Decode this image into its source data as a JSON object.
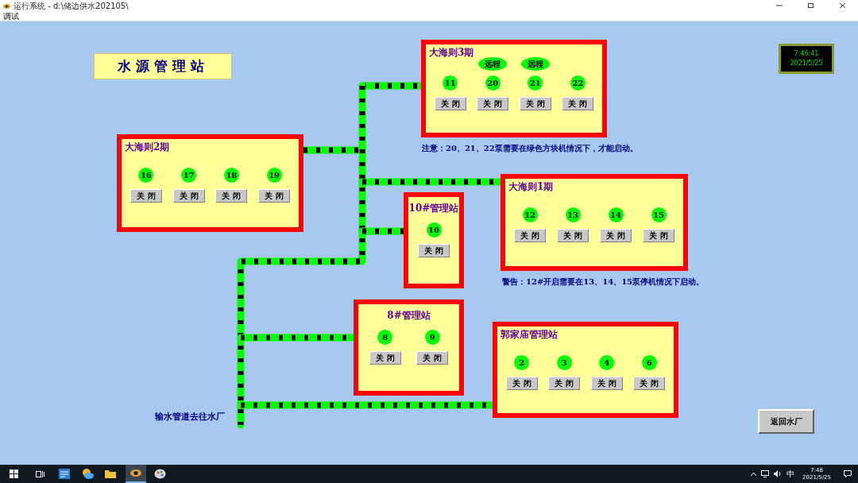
{
  "window": {
    "title": "运行系统 - d:\\储边供水202105\\",
    "menu": [
      "调试"
    ]
  },
  "header": {
    "title": "水源管理站"
  },
  "clock": {
    "time": "7:46:41",
    "date": "2021/5/25"
  },
  "stations": [
    {
      "title": "大海则3期",
      "kind": "wide",
      "pumps": [
        {
          "label": "11",
          "running": true,
          "button": "关闭"
        },
        {
          "label": "20",
          "running": true,
          "remote": "远程",
          "button": "关闭"
        },
        {
          "label": "21",
          "running": true,
          "remote": "远程",
          "button": "关闭"
        },
        {
          "label": "22",
          "running": true,
          "button": "关闭"
        }
      ]
    },
    {
      "title": "大海则2期",
      "kind": "wide",
      "pumps": [
        {
          "label": "16",
          "running": true,
          "button": "关闭"
        },
        {
          "label": "17",
          "running": true,
          "button": "关闭"
        },
        {
          "label": "18",
          "running": true,
          "button": "关闭"
        },
        {
          "label": "19",
          "running": true,
          "button": "关闭"
        }
      ]
    },
    {
      "title": "大海则1期",
      "kind": "wide",
      "pumps": [
        {
          "label": "12",
          "running": true,
          "button": "关闭"
        },
        {
          "label": "13",
          "running": true,
          "button": "关闭"
        },
        {
          "label": "14",
          "running": true,
          "button": "关闭"
        },
        {
          "label": "15",
          "running": true,
          "button": "关闭"
        }
      ]
    },
    {
      "title": "10#管理站",
      "kind": "narrow",
      "pumps": [
        {
          "label": "10",
          "running": true,
          "button": "关闭"
        }
      ]
    },
    {
      "title": "8#管理站",
      "kind": "narrow",
      "pumps": [
        {
          "label": "8",
          "running": true,
          "button": "关闭"
        },
        {
          "label": "9",
          "running": true,
          "button": "关闭"
        }
      ]
    },
    {
      "title": "郭家庙管理站",
      "kind": "wide",
      "pumps": [
        {
          "label": "2",
          "running": true,
          "button": "关闭"
        },
        {
          "label": "3",
          "running": true,
          "button": "关闭"
        },
        {
          "label": "4",
          "running": true,
          "button": "关闭"
        },
        {
          "label": "6",
          "running": true,
          "button": "关闭"
        }
      ]
    }
  ],
  "notes": [
    "注意：20、21、22泵需要在绿色方块机情况下，才能启动。",
    "警告：12#开启需要在13、14、15泵停机情况下启动。"
  ],
  "pipe_label": "输水管道去往水厂",
  "return_button": "返回水厂",
  "taskbar": {
    "ime": "中",
    "time": "7:48",
    "date": "2021/5/25"
  }
}
